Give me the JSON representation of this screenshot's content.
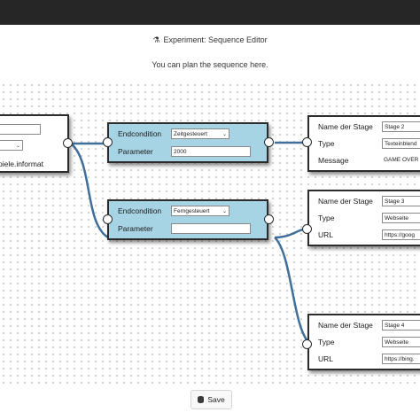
{
  "header": {
    "title": "Experiment: Sequence Editor",
    "subtitle": "You can plan the sequence here.",
    "title_icon": "experiment-icon"
  },
  "left_node": {
    "text": "piele.informat"
  },
  "end_node_1": {
    "endcondition_label": "Endcondition",
    "endcondition_value": "Zeitgesteuert",
    "parameter_label": "Parameter",
    "parameter_value": "2000"
  },
  "end_node_2": {
    "endcondition_label": "Endcondition",
    "endcondition_value": "Ferngesteuert",
    "parameter_label": "Parameter",
    "parameter_value": ""
  },
  "stage_2": {
    "name_label": "Name der Stage",
    "name_value": "Stage 2",
    "type_label": "Type",
    "type_value": "Texteinblend",
    "extra_label": "Message",
    "extra_value": "GAME OVER"
  },
  "stage_3": {
    "name_label": "Name der Stage",
    "name_value": "Stage 3",
    "type_label": "Type",
    "type_value": "Webseite",
    "extra_label": "URL",
    "extra_value": "https://goog"
  },
  "stage_4": {
    "name_label": "Name der Stage",
    "name_value": "Stage 4",
    "type_label": "Type",
    "type_value": "Webseite",
    "extra_label": "URL",
    "extra_value": "https://bing."
  },
  "footer": {
    "save_label": "Save",
    "save_icon": "database-icon"
  },
  "colors": {
    "topbar": "#262626",
    "node_blue": "#a7d4e4",
    "wire": "#3f6f9a"
  }
}
